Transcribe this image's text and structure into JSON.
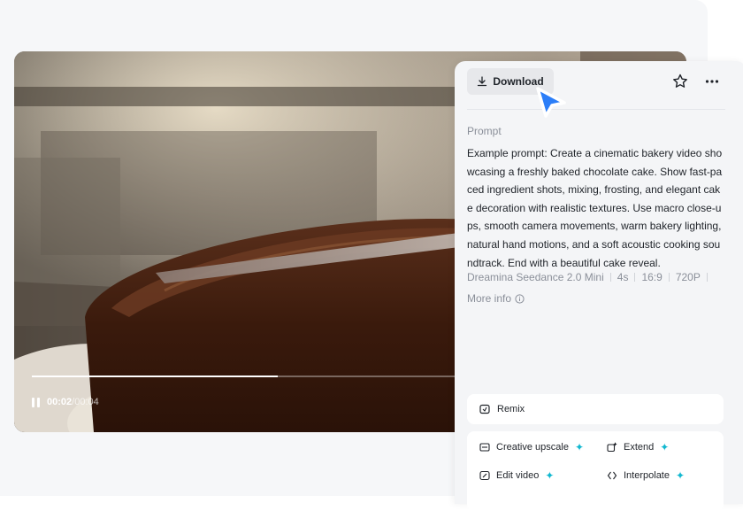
{
  "video": {
    "current_time": "00:02",
    "separator": "/",
    "total_time": "00:04",
    "progress": 0.58
  },
  "panel": {
    "download_label": "Download",
    "prompt_label": "Prompt",
    "prompt_text": "Example prompt: Create a cinematic bakery video showcasing a freshly baked chocolate cake. Show fast-paced ingredient shots, mixing, frosting, and elegant cake decoration with realistic textures. Use macro close-ups, smooth camera movements, warm bakery lighting, natural hand motions, and a soft acoustic cooking soundtrack. End with a beautiful cake reveal.",
    "meta": [
      "Dreamina Seedance 2.0 Mini",
      "4s",
      "16:9",
      "720P"
    ],
    "more_info": "More info",
    "remix_label": "Remix",
    "tools": [
      {
        "label": "Creative upscale"
      },
      {
        "label": "Extend"
      },
      {
        "label": "Edit video"
      },
      {
        "label": "Interpolate"
      }
    ]
  },
  "colors": {
    "accent_spark": "#12b8d0",
    "cursor": "#2c7ef8"
  }
}
